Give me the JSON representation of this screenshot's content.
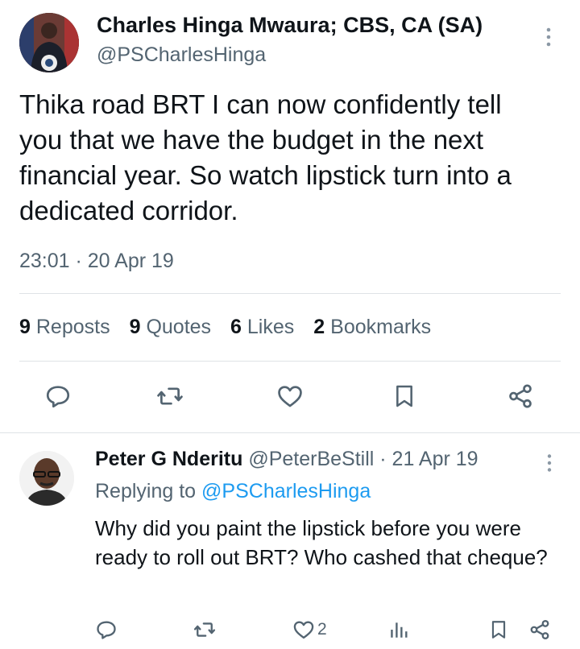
{
  "main_tweet": {
    "author_name": "Charles Hinga Mwaura; CBS, CA (SA)",
    "author_handle": "@PSCharlesHinga",
    "text": "Thika road BRT I can now confidently tell you that we have the budget in the next financial year. So watch lipstick turn into a dedicated corridor.",
    "time": "23:01 · 20 Apr 19",
    "stats": {
      "reposts_count": "9",
      "reposts_label": "Reposts",
      "quotes_count": "9",
      "quotes_label": "Quotes",
      "likes_count": "6",
      "likes_label": "Likes",
      "bookmarks_count": "2",
      "bookmarks_label": "Bookmarks"
    },
    "actions": [
      "reply-icon",
      "repost-icon",
      "like-icon",
      "bookmark-icon",
      "share-icon"
    ]
  },
  "reply": {
    "author_name": "Peter G Nderitu",
    "author_handle": "@PeterBeStill",
    "date": "· 21 Apr 19",
    "replying_prefix": "Replying to",
    "replying_to": "@PSCharlesHinga",
    "text": "Why did you paint the lipstick before you were ready to roll out BRT? Who cashed that cheque?",
    "like_count": "2",
    "actions": [
      "reply-icon",
      "repost-icon",
      "like-icon",
      "views-icon",
      "bookmark-icon",
      "share-icon"
    ]
  },
  "colors": {
    "text": "#0f1419",
    "secondary": "#536471",
    "accent": "#1d9bf0",
    "divider": "#dfe3e6"
  }
}
